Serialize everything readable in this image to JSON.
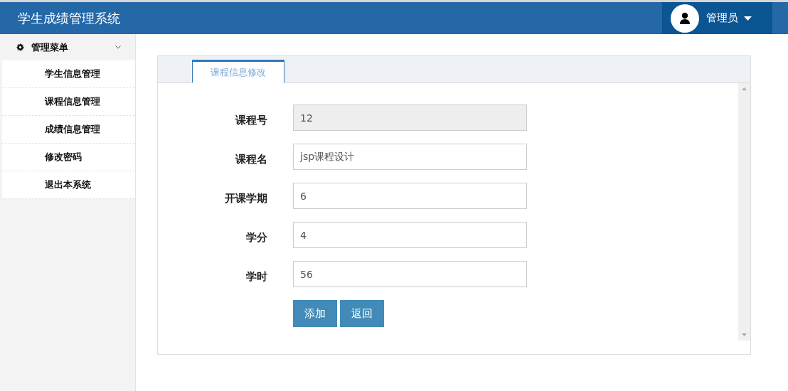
{
  "header": {
    "title": "学生成绩管理系统",
    "user": "管理员"
  },
  "sidebar": {
    "menu_title": "管理菜单",
    "expanded": true,
    "items": [
      {
        "label": "学生信息管理"
      },
      {
        "label": "课程信息管理"
      },
      {
        "label": "成绩信息管理"
      },
      {
        "label": "修改密码"
      },
      {
        "label": "退出本系统"
      }
    ]
  },
  "tabs": [
    {
      "label": "课程信息修改",
      "selected": true
    }
  ],
  "form": {
    "fields": [
      {
        "label": "课程号",
        "value": "12",
        "disabled": true
      },
      {
        "label": "课程名",
        "value": "jsp课程设计",
        "disabled": false
      },
      {
        "label": "开课学期",
        "value": "6",
        "disabled": false
      },
      {
        "label": "学分",
        "value": "4",
        "disabled": false
      },
      {
        "label": "学时",
        "value": "56",
        "disabled": false
      }
    ],
    "buttons": [
      "添加",
      "返回"
    ]
  }
}
